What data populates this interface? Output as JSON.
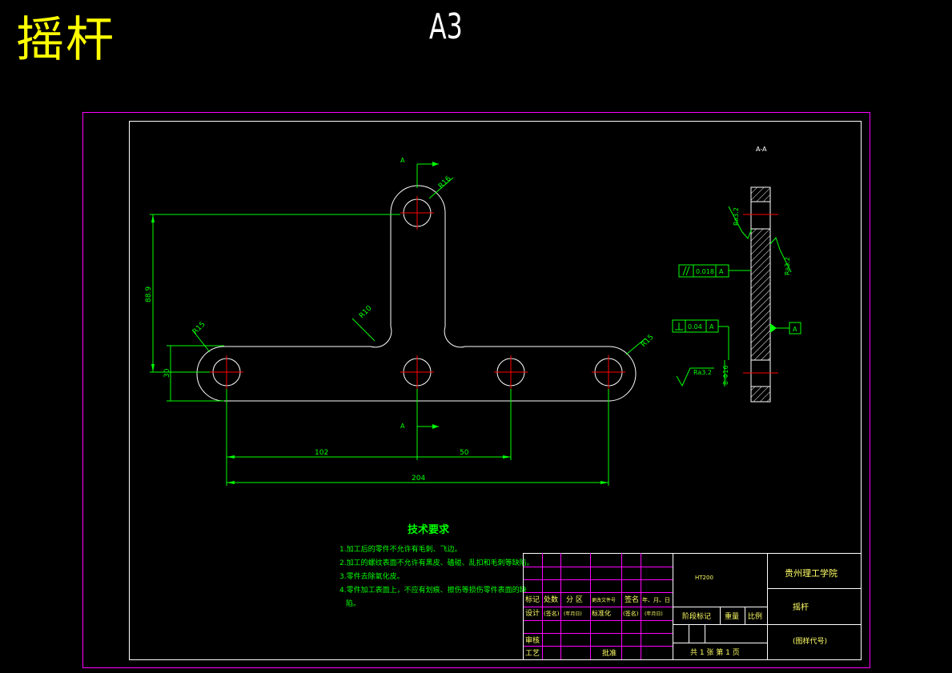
{
  "title": "摇杆",
  "sheet_size": "A3",
  "dimensions": {
    "r16": "R16",
    "r10": "R10",
    "r15_left": "R15",
    "r15_right": "R15",
    "vertical": "88.9",
    "height": "30",
    "d102": "102",
    "d50": "50",
    "d204": "204"
  },
  "section": {
    "label_top": "A",
    "label_bottom": "A",
    "view_label": "A-A",
    "parallelism_value": "0.018",
    "parallelism_datum": "A",
    "perp_value": "0.04",
    "perp_datum": "A",
    "datum": "A",
    "rough_1": "Ra3.2",
    "rough_2": "Ra3.2",
    "rough_3": "Ra3.2",
    "hole_dim": "8-Φ16"
  },
  "tech": {
    "heading": "技术要求",
    "lines": [
      "1.加工后的零件不允许有毛刺、飞边。",
      "2.加工的螺纹表面不允许有黑皮、磕碰、乱扣和毛刺等缺陷。",
      "3.零件去除氧化皮。",
      "4.零件加工表面上，不应有划痕、擦伤等损伤零件表面的缺",
      "陷。"
    ]
  },
  "title_block": {
    "material": "HT200",
    "school": "贵州理工学院",
    "part_name": "摇杆",
    "drawing_no": "(图样代号)",
    "h_mark": "标记",
    "h_count": "处数",
    "h_zone": "分 区",
    "h_docno": "更改文件号",
    "h_sign": "签名",
    "h_date": "年、月、日",
    "r_design": "设计",
    "r_sign1": "(签名)",
    "r_date1": "(年月日)",
    "r_std": "标准化",
    "r_sign2": "(签名)",
    "r_date2": "(年月日)",
    "r_stage": "阶段标记",
    "r_weight": "重量",
    "r_scale": "比例",
    "r_review": "审核",
    "r_process": "工艺",
    "r_approve": "批准",
    "sheets": "共 1 张  第 1 页"
  }
}
